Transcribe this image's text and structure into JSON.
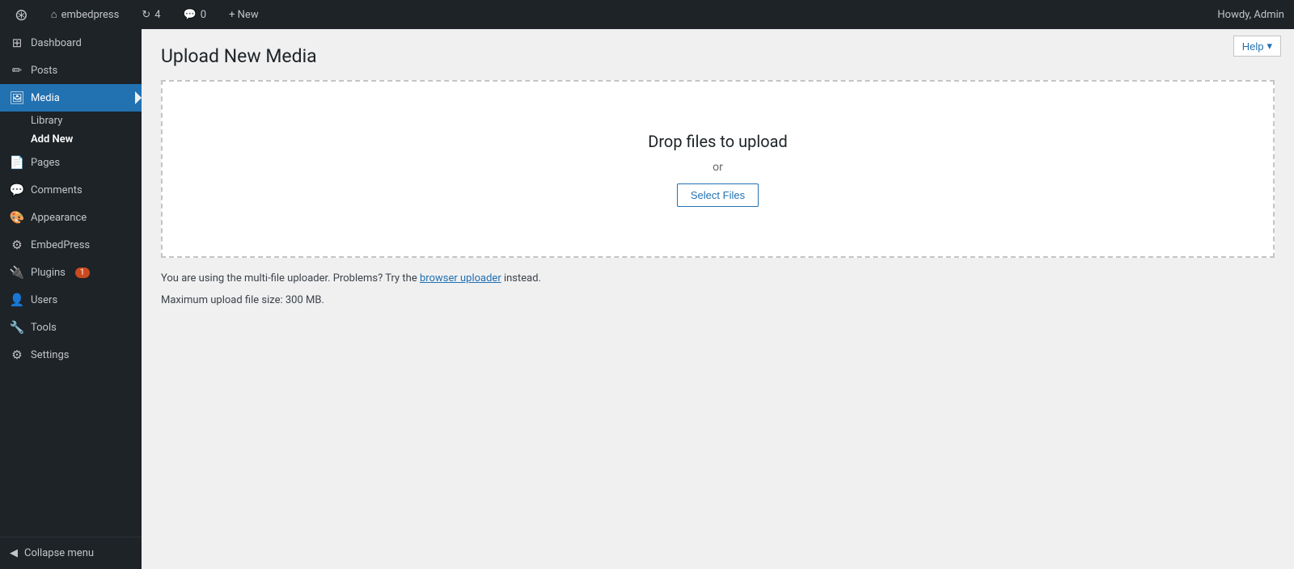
{
  "adminBar": {
    "wpLogo": "⊞",
    "siteName": "embedpress",
    "updates": "4",
    "comments": "0",
    "new": "+ New",
    "howdy": "Howdy, Admin",
    "updateIcon": "↻",
    "commentIcon": "💬",
    "helpLabel": "Help",
    "helpArrow": "▾"
  },
  "sidebar": {
    "dashboardLabel": "Dashboard",
    "postsLabel": "Posts",
    "mediaLabel": "Media",
    "mediaLibraryLabel": "Library",
    "mediaAddNewLabel": "Add New",
    "pagesLabel": "Pages",
    "commentsLabel": "Comments",
    "appearanceLabel": "Appearance",
    "embedpressLabel": "EmbedPress",
    "pluginsLabel": "Plugins",
    "pluginsBadge": "1",
    "usersLabel": "Users",
    "toolsLabel": "Tools",
    "settingsLabel": "Settings",
    "collapseLabel": "Collapse menu"
  },
  "content": {
    "pageTitle": "Upload New Media",
    "dropZoneText": "Drop files to upload",
    "dropZoneOr": "or",
    "selectFilesLabel": "Select Files",
    "infoText": "You are using the multi-file uploader. Problems? Try the",
    "browserUploaderLink": "browser uploader",
    "infoTextEnd": " instead.",
    "maxSizeLabel": "Maximum upload file size: 300 MB."
  }
}
